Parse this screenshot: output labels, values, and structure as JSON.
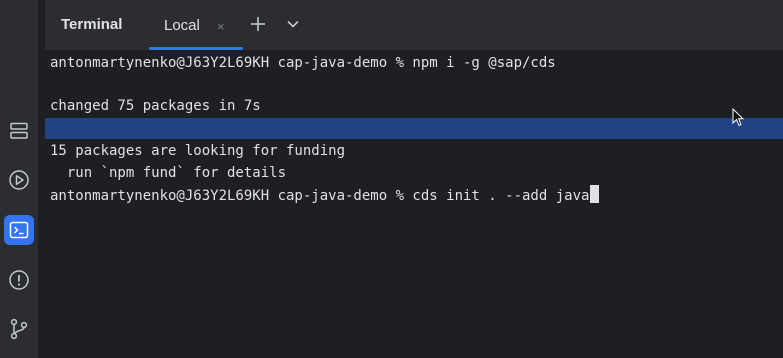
{
  "tool_window": {
    "title": "Terminal",
    "active_tab": "Local",
    "close_glyph": "×",
    "add_glyph": "+",
    "icons": [
      "close-icon",
      "plus-icon",
      "chevron-down-icon"
    ]
  },
  "left_strip": {
    "icons": [
      "services-icon",
      "run-icon",
      "terminal-icon",
      "problems-icon",
      "git-icon"
    ],
    "active": "terminal-icon",
    "accent_color": "#3574f0"
  },
  "terminal": {
    "lines": [
      "antonmartynenko@J63Y2L69KH cap-java-demo % npm i -g @sap/cds",
      "",
      "changed 75 packages in 7s",
      "",
      "15 packages are looking for funding",
      "  run `npm fund` for details",
      "antonmartynenko@J63Y2L69KH cap-java-demo % cds init . --add java"
    ],
    "highlight_color": "#214283"
  }
}
